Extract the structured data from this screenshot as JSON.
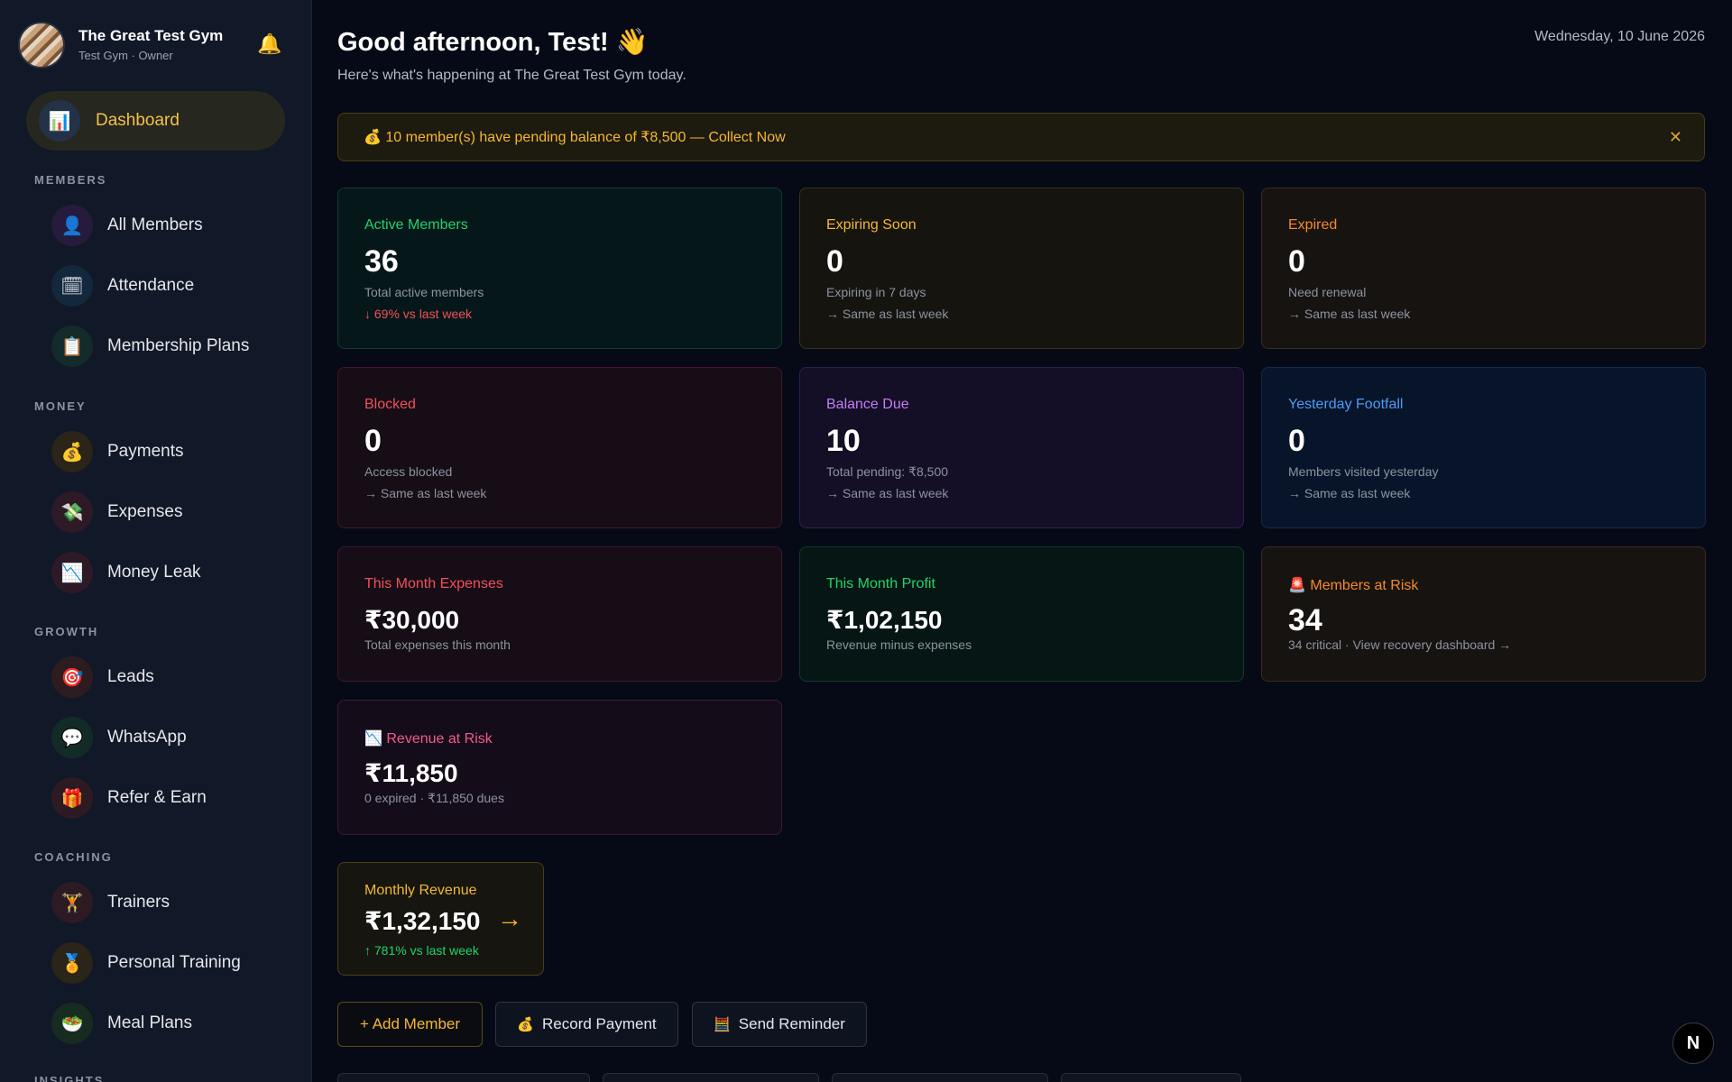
{
  "sidebar": {
    "gym_name": "The Great Test Gym",
    "gym_sub": "Test Gym · Owner",
    "active": {
      "label": "Dashboard",
      "icon": "📊"
    },
    "sections": [
      {
        "title": "MEMBERS",
        "items": [
          {
            "label": "All Members",
            "icon": "👤",
            "bg": "#261a3d"
          },
          {
            "label": "Attendance",
            "icon": "🗓",
            "bg": "#14283d"
          },
          {
            "label": "Membership Plans",
            "icon": "📋",
            "bg": "#132b2a"
          }
        ]
      },
      {
        "title": "MONEY",
        "items": [
          {
            "label": "Payments",
            "icon": "💰",
            "bg": "#2a2419"
          },
          {
            "label": "Expenses",
            "icon": "💸",
            "bg": "#2d1a26"
          },
          {
            "label": "Money Leak",
            "icon": "📉",
            "bg": "#2d1a26"
          }
        ]
      },
      {
        "title": "GROWTH",
        "items": [
          {
            "label": "Leads",
            "icon": "🎯",
            "bg": "#2d1c1f"
          },
          {
            "label": "WhatsApp",
            "icon": "💬",
            "bg": "#132b27"
          },
          {
            "label": "Refer & Earn",
            "icon": "🎁",
            "bg": "#2d1a22"
          }
        ]
      },
      {
        "title": "COACHING",
        "items": [
          {
            "label": "Trainers",
            "icon": "🏋",
            "bg": "#2d1a22"
          },
          {
            "label": "Personal Training",
            "icon": "🏅",
            "bg": "#2a2419"
          },
          {
            "label": "Meal Plans",
            "icon": "🥗",
            "bg": "#182b20"
          }
        ]
      },
      {
        "title": "INSIGHTS",
        "items": []
      }
    ]
  },
  "header": {
    "greeting": "Good afternoon, Test! 👋",
    "subtitle": "Here's what's happening at The Great Test Gym today.",
    "date": "Wednesday, 10 June 2026"
  },
  "banner": {
    "text": "💰 10 member(s) have pending balance of ₹8,500 — Collect Now",
    "close": "✕"
  },
  "cards": [
    {
      "title": "Active Members",
      "value": "36",
      "sub": "Total active members",
      "trend": "↓ 69% vs last week",
      "title_color": "#22d36a",
      "trend_color": "#f0505a",
      "tone": "t-green"
    },
    {
      "title": "Expiring Soon",
      "value": "0",
      "sub": "Expiring in 7 days",
      "trend": "→ Same as last week",
      "title_color": "#f5b82e",
      "trend_color": "#8c93a0",
      "tone": "t-amber"
    },
    {
      "title": "Expired",
      "value": "0",
      "sub": "Need renewal",
      "trend": "→ Same as last week",
      "title_color": "#f58a2a",
      "trend_color": "#8c93a0",
      "tone": "t-orange"
    },
    {
      "title": "Blocked",
      "value": "0",
      "sub": "Access blocked",
      "trend": "→ Same as last week",
      "title_color": "#f0505a",
      "trend_color": "#8c93a0",
      "tone": "t-red"
    },
    {
      "title": "Balance Due",
      "value": "10",
      "sub": "Total pending: ₹8,500",
      "trend": "→ Same as last week",
      "title_color": "#c47cf5",
      "trend_color": "#8c93a0",
      "tone": "t-purple"
    },
    {
      "title": "Yesterday Footfall",
      "value": "0",
      "sub": "Members visited yesterday",
      "trend": "→ Same as last week",
      "title_color": "#4f9bf5",
      "trend_color": "#8c93a0",
      "tone": "t-blue"
    },
    {
      "title": "This Month Expenses",
      "value": "₹30,000",
      "sub": "Total expenses this month",
      "trend": "",
      "title_color": "#f0505a",
      "trend_color": "#8c93a0",
      "tone": "t-red"
    },
    {
      "title": "This Month Profit",
      "value": "₹1,02,150",
      "sub": "Revenue minus expenses",
      "trend": "",
      "title_color": "#22d36a",
      "trend_color": "#8c93a0",
      "tone": "t-darkgreen"
    },
    {
      "title": "🚨 Members at Risk",
      "value": "34",
      "sub": "34 critical · View recovery dashboard →",
      "trend": "",
      "title_color": "#f58a2a",
      "trend_color": "#8c93a0",
      "tone": "t-orange"
    },
    {
      "title": "📉 Revenue at Risk",
      "value": "₹11,850",
      "sub": "0 expired · ₹11,850 dues",
      "trend": "",
      "title_color": "#f05a8c",
      "trend_color": "#8c93a0",
      "tone": "t-pink"
    }
  ],
  "revenue": {
    "title": "Monthly Revenue",
    "value": "₹1,32,150",
    "arrow": "→",
    "trend": "↑ 781% vs last week"
  },
  "actions": {
    "add_member": "+ Add Member",
    "record_payment": "Record Payment",
    "record_payment_icon": "💰",
    "send_reminder": "Send Reminder",
    "send_reminder_icon": "🧮"
  },
  "badge": "N"
}
